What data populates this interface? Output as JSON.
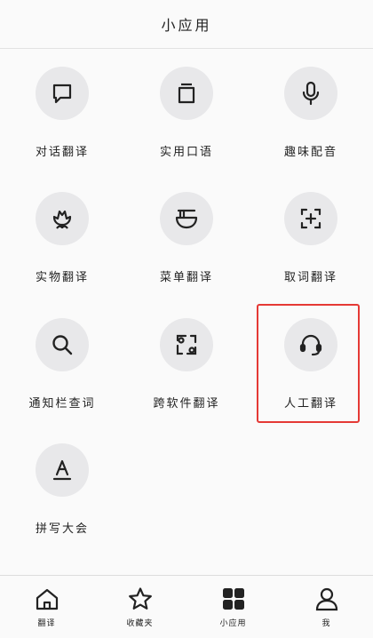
{
  "header": {
    "title": "小应用"
  },
  "apps": [
    {
      "label": "对话翻译",
      "icon": "chat-bubble-icon"
    },
    {
      "label": "实用口语",
      "icon": "phrasebook-icon"
    },
    {
      "label": "趣味配音",
      "icon": "microphone-icon"
    },
    {
      "label": "实物翻译",
      "icon": "flower-icon"
    },
    {
      "label": "菜单翻译",
      "icon": "noodle-bowl-icon"
    },
    {
      "label": "取词翻译",
      "icon": "scan-plus-icon"
    },
    {
      "label": "通知栏查词",
      "icon": "search-icon"
    },
    {
      "label": "跨软件翻译",
      "icon": "cross-app-icon"
    },
    {
      "label": "人工翻译",
      "icon": "headset-icon"
    },
    {
      "label": "拼写大会",
      "icon": "spelling-a-icon"
    }
  ],
  "highlight": {
    "color": "#e53935",
    "target": "人工翻译"
  },
  "tabs": [
    {
      "label": "翻译",
      "icon": "home-icon"
    },
    {
      "label": "收藏夹",
      "icon": "star-icon"
    },
    {
      "label": "小应用",
      "icon": "apps-grid-icon",
      "active": true
    },
    {
      "label": "我",
      "icon": "user-icon"
    }
  ]
}
